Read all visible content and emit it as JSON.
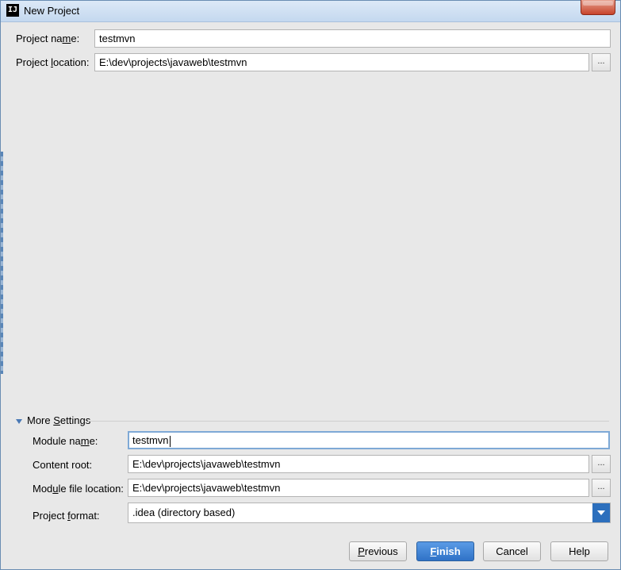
{
  "window": {
    "title": "New Project",
    "app_icon_text": "IJ"
  },
  "project": {
    "name_label_pre": "Project na",
    "name_label_u": "m",
    "name_label_post": "e:",
    "name_value": "testmvn",
    "location_label_pre": "Project ",
    "location_label_u": "l",
    "location_label_post": "ocation:",
    "location_value": "E:\\dev\\projects\\javaweb\\testmvn",
    "browse_label": "..."
  },
  "more_settings": {
    "title_pre": "More ",
    "title_u": "S",
    "title_post": "ettings",
    "module_name_label_pre": "Module na",
    "module_name_label_u": "m",
    "module_name_label_post": "e:",
    "module_name_value": "testmvn",
    "content_root_label": "Content root:",
    "content_root_value": "E:\\dev\\projects\\javaweb\\testmvn",
    "module_file_label_pre": "Mod",
    "module_file_label_u": "u",
    "module_file_label_post": "le file location:",
    "module_file_value": "E:\\dev\\projects\\javaweb\\testmvn",
    "format_label_pre": "Project ",
    "format_label_u": "f",
    "format_label_post": "ormat:",
    "format_value": ".idea (directory based)",
    "browse_label": "..."
  },
  "buttons": {
    "previous_u": "P",
    "previous_rest": "revious",
    "finish_u": "F",
    "finish_rest": "inish",
    "cancel": "Cancel",
    "help": "Help"
  },
  "colors": {
    "primary": "#2f72c7",
    "dropdown_arrow": "#2c6fbd"
  }
}
